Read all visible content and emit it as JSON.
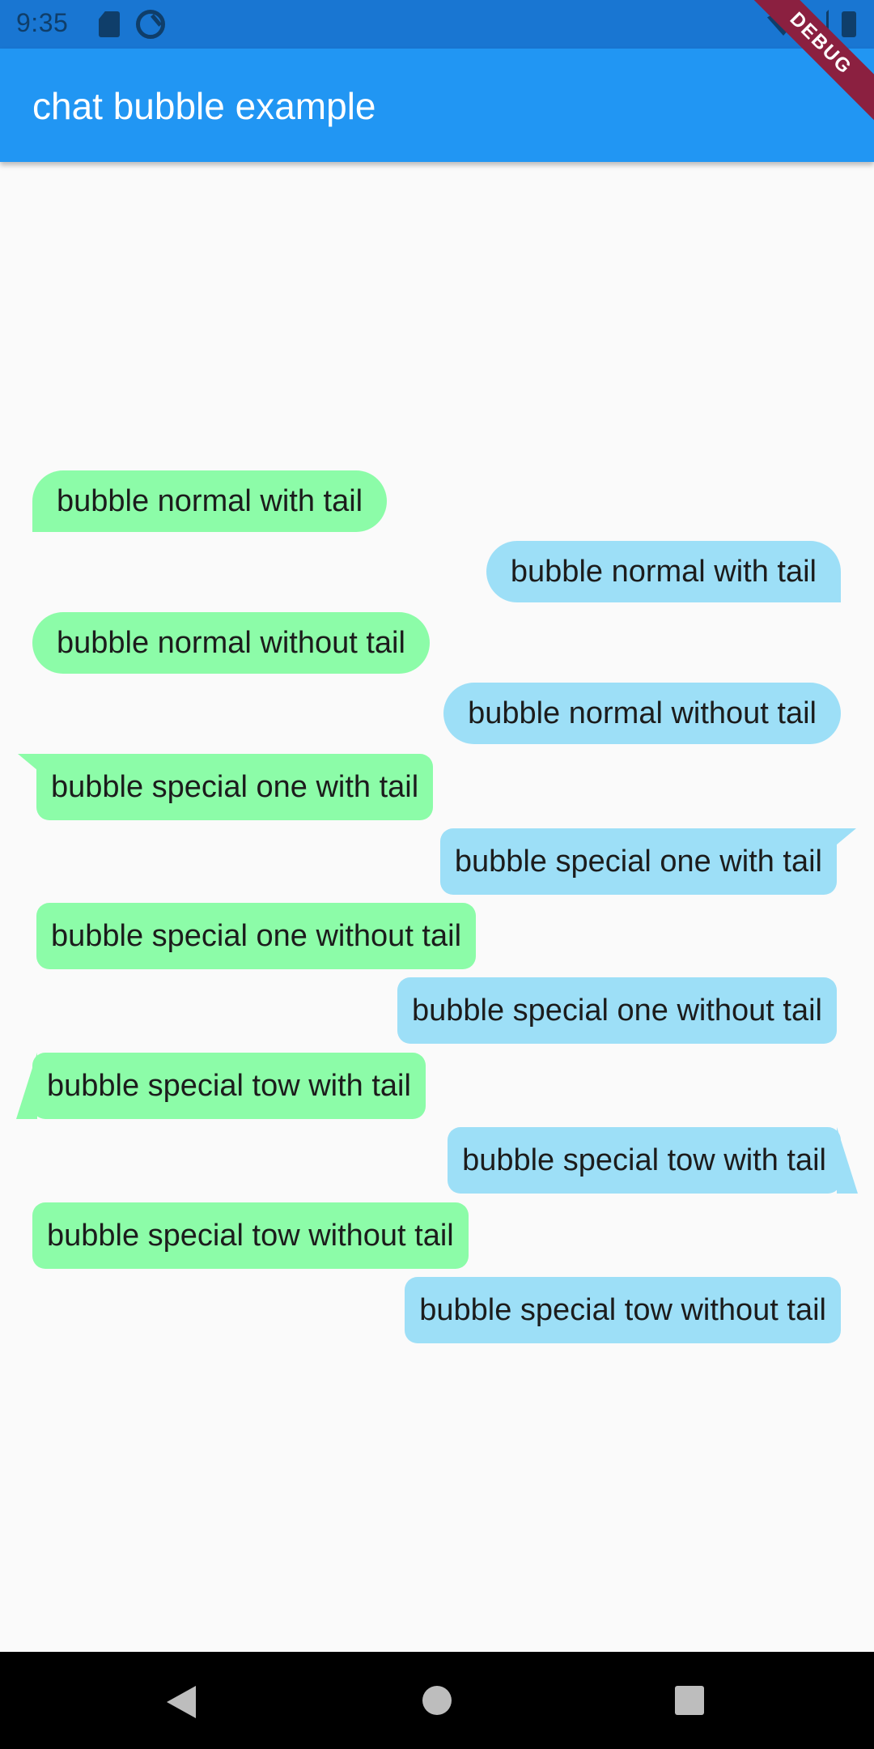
{
  "status_bar": {
    "time": "9:35",
    "icons": [
      "sd-card-icon",
      "sync-icon",
      "wifi-icon",
      "signal-icon",
      "battery-icon"
    ]
  },
  "app_bar": {
    "title": "chat bubble example",
    "color": "#2196F3"
  },
  "debug_banner": "DEBUG",
  "bubbles": [
    {
      "text": "bubble normal with tail",
      "side": "left",
      "color": "#8CFCA8"
    },
    {
      "text": "bubble normal with tail",
      "side": "right",
      "color": "#9DDFF7"
    },
    {
      "text": "bubble normal without tail",
      "side": "left",
      "color": "#8CFCA8"
    },
    {
      "text": "bubble normal without tail",
      "side": "right",
      "color": "#9DDFF7"
    },
    {
      "text": "bubble special one with tail",
      "side": "left",
      "color": "#8CFCA8"
    },
    {
      "text": "bubble special one with tail",
      "side": "right",
      "color": "#9DDFF7"
    },
    {
      "text": "bubble special one without tail",
      "side": "left",
      "color": "#8CFCA8"
    },
    {
      "text": "bubble special one without tail",
      "side": "right",
      "color": "#9DDFF7"
    },
    {
      "text": "bubble special tow with tail",
      "side": "left",
      "color": "#8CFCA8"
    },
    {
      "text": "bubble special tow with tail",
      "side": "right",
      "color": "#9DDFF7"
    },
    {
      "text": "bubble special tow without tail",
      "side": "left",
      "color": "#8CFCA8"
    },
    {
      "text": "bubble special tow without tail",
      "side": "right",
      "color": "#9DDFF7"
    }
  ],
  "nav_bar": {
    "icons": [
      "back-icon",
      "home-icon",
      "recents-icon"
    ]
  }
}
